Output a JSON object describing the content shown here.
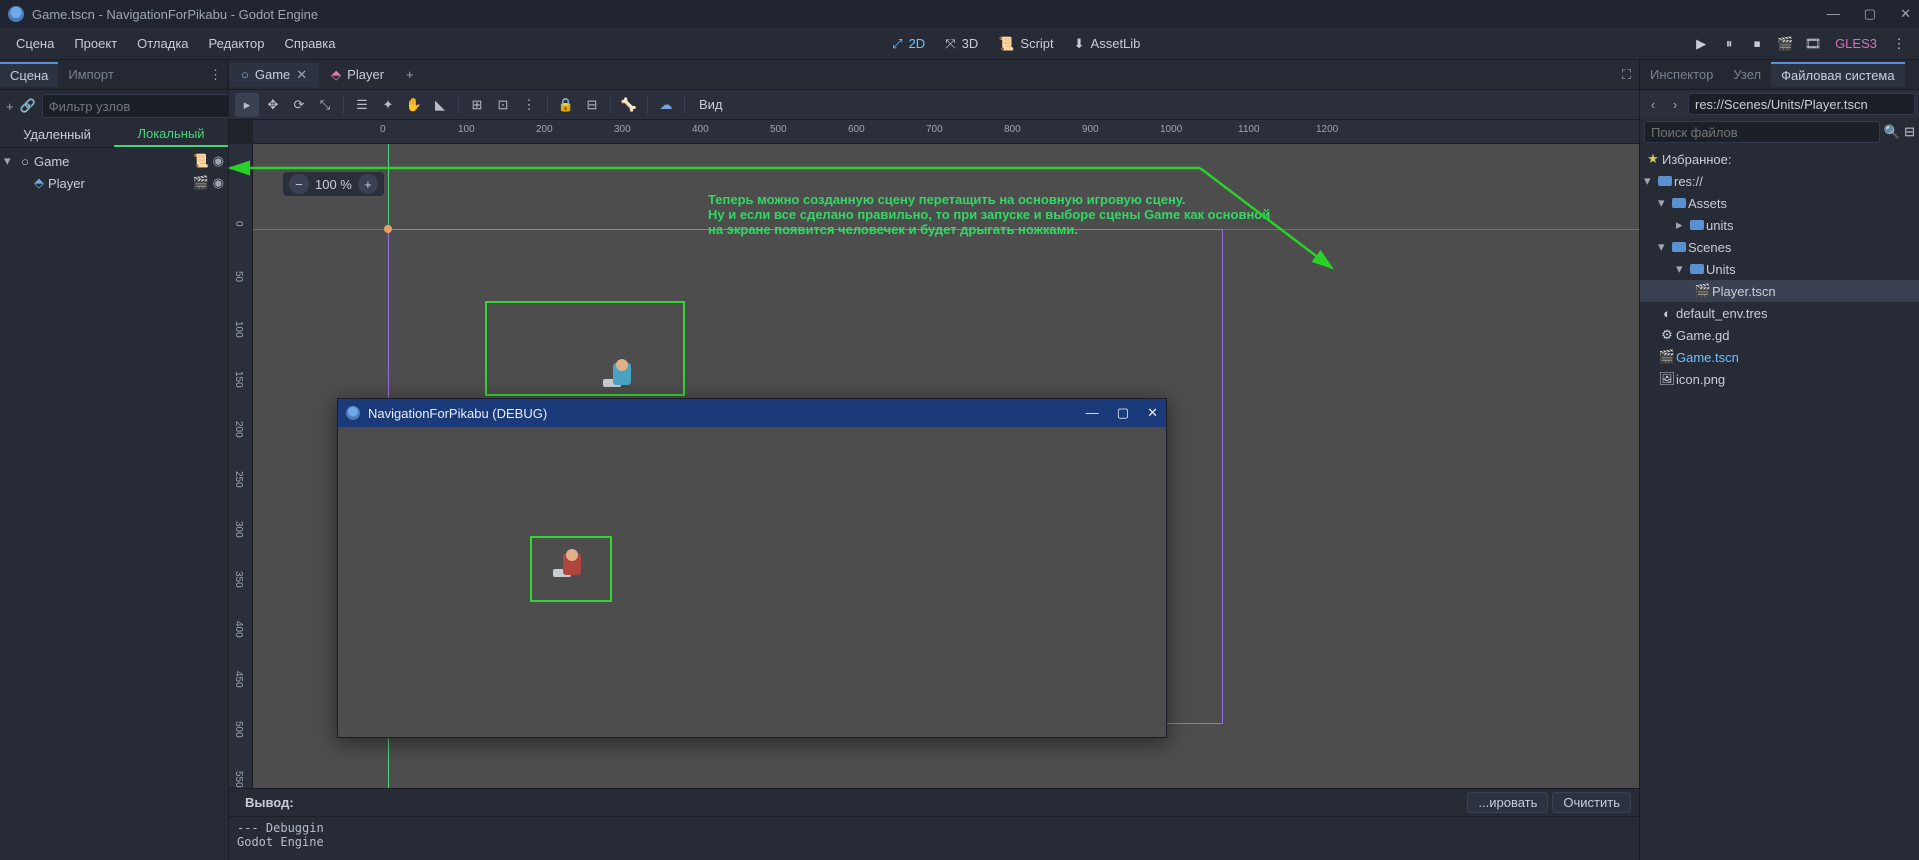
{
  "title": "Game.tscn - NavigationForPikabu - Godot Engine",
  "menu": {
    "scene": "Сцена",
    "project": "Проект",
    "debug": "Отладка",
    "editor": "Редактор",
    "help": "Справка"
  },
  "workspace": {
    "_2d": "2D",
    "_3d": "3D",
    "script": "Script",
    "assetlib": "AssetLib"
  },
  "renderer": "GLES3",
  "left_panel": {
    "tabs": {
      "scene": "Сцена",
      "import": "Импорт"
    },
    "filter_placeholder": "Фильтр узлов",
    "subtabs": {
      "remote": "Удаленный",
      "local": "Локальный"
    },
    "tree": {
      "root": "Game",
      "child": "Player"
    }
  },
  "scene_tabs": {
    "game": "Game",
    "player": "Player"
  },
  "zoom": "100 %",
  "view_menu": "Вид",
  "note_line1": "Теперь можно созданную сцену перетащить на основную игровую сцену.",
  "note_line2": "Ну и если все сделано правильно, то при запуске и выборе сцены Game как основной",
  "note_line3": "на экране появится человечек и будет дрыгать ножками.",
  "debug_window": {
    "title": "NavigationForPikabu (DEBUG)"
  },
  "bottom": {
    "output": "Вывод:",
    "copy": "...ировать",
    "clear": "Очистить",
    "text": "--- Debuggin\nGodot Engine"
  },
  "right_panel": {
    "tabs": {
      "inspector": "Инспектор",
      "node": "Узел",
      "fs": "Файловая система"
    },
    "path": "res://Scenes/Units/Player.tscn",
    "search_placeholder": "Поиск файлов",
    "favorites": "Избранное:",
    "res": "res://",
    "assets": "Assets",
    "units_l": "units",
    "scenes": "Scenes",
    "units": "Units",
    "player_tscn": "Player.tscn",
    "default_env": "default_env.tres",
    "game_gd": "Game.gd",
    "game_tscn": "Game.tscn",
    "icon_png": "icon.png"
  },
  "ruler_h": [
    "0",
    "100",
    "200",
    "300",
    "400",
    "500",
    "600",
    "700",
    "800",
    "900",
    "1000",
    "1100",
    "1200"
  ],
  "ruler_v": [
    "0",
    "50",
    "100",
    "150",
    "200",
    "250",
    "300",
    "350",
    "400",
    "450",
    "500",
    "550"
  ]
}
